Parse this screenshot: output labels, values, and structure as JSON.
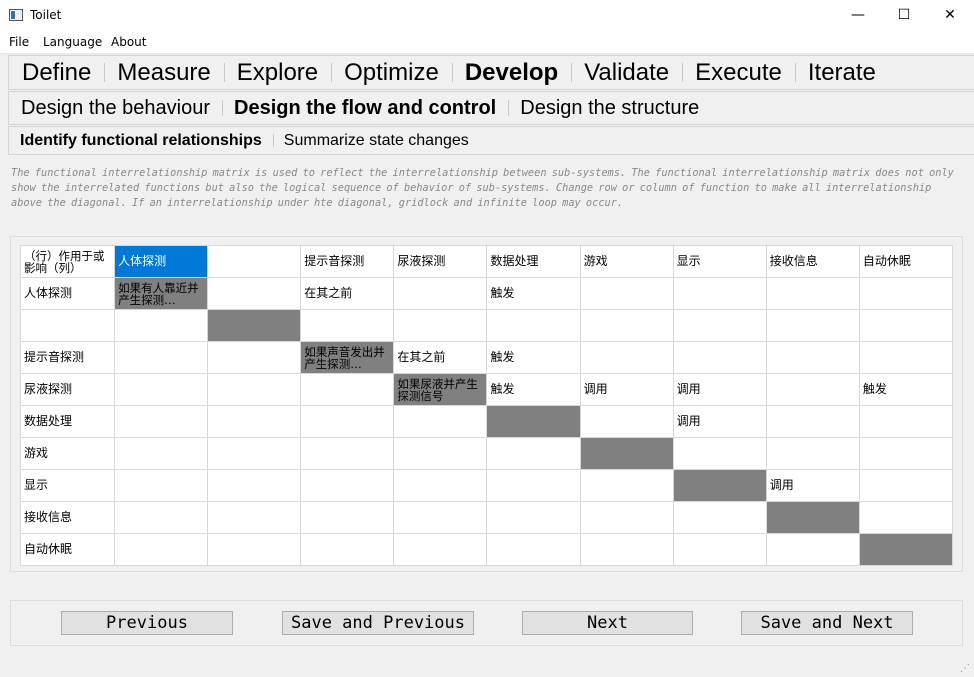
{
  "window": {
    "title": "Toilet",
    "minimize": "—",
    "maximize": "☐",
    "close": "✕"
  },
  "menubar": {
    "items": [
      "File",
      "Language",
      "About"
    ]
  },
  "phase_tabs": [
    "Define",
    "Measure",
    "Explore",
    "Optimize",
    "Develop",
    "Validate",
    "Execute",
    "Iterate"
  ],
  "phase_active": "Develop",
  "design_tabs": [
    "Design the behaviour",
    "Design the flow and control",
    "Design the structure"
  ],
  "design_active": "Design the flow and control",
  "sub_tabs": [
    "Identify functional relationships",
    "Summarize state changes"
  ],
  "sub_active": "Identify functional relationships",
  "description": "The functional interrelationship matrix is used to reflect the interrelationship between sub-systems. The functional interrelationship matrix does not only show the interrelated functions but also the logical sequence of behavior of sub-systems. Change row or column of function to make all interrelationship above the diagonal. If an interrelationship under hte diagonal, gridlock and infinite loop may occur.",
  "matrix": {
    "corner": "（行）作用于或影响（列）",
    "columns": [
      "人体探测",
      "",
      "提示音探测",
      "尿液探测",
      "数据处理",
      "游戏",
      "显示",
      "接收信息",
      "自动休眠"
    ],
    "rows": [
      {
        "label": "人体探测",
        "cells": [
          "如果有人靠近并产生探测…",
          "",
          "在其之前",
          "",
          "触发",
          "",
          "",
          "",
          ""
        ]
      },
      {
        "label": "",
        "cells": [
          "",
          "",
          "",
          "",
          "",
          "",
          "",
          "",
          ""
        ]
      },
      {
        "label": "提示音探测",
        "cells": [
          "",
          "",
          "如果声音发出并产生探测…",
          "在其之前",
          "触发",
          "",
          "",
          "",
          ""
        ]
      },
      {
        "label": "尿液探测",
        "cells": [
          "",
          "",
          "",
          "如果尿液并产生探测信号",
          "触发",
          "调用",
          "调用",
          "",
          "触发"
        ]
      },
      {
        "label": "数据处理",
        "cells": [
          "",
          "",
          "",
          "",
          "",
          "",
          "调用",
          "",
          ""
        ]
      },
      {
        "label": "游戏",
        "cells": [
          "",
          "",
          "",
          "",
          "",
          "",
          "",
          "",
          ""
        ]
      },
      {
        "label": "显示",
        "cells": [
          "",
          "",
          "",
          "",
          "",
          "",
          "",
          "调用",
          ""
        ]
      },
      {
        "label": "接收信息",
        "cells": [
          "",
          "",
          "",
          "",
          "",
          "",
          "",
          "",
          ""
        ]
      },
      {
        "label": "自动休眠",
        "cells": [
          "",
          "",
          "",
          "",
          "",
          "",
          "",
          "",
          ""
        ]
      }
    ]
  },
  "buttons": {
    "previous": "Previous",
    "save_previous": "Save and Previous",
    "next": "Next",
    "save_next": "Save and Next"
  },
  "colors": {
    "selection": "#0078d7",
    "diagonal": "#808080"
  }
}
